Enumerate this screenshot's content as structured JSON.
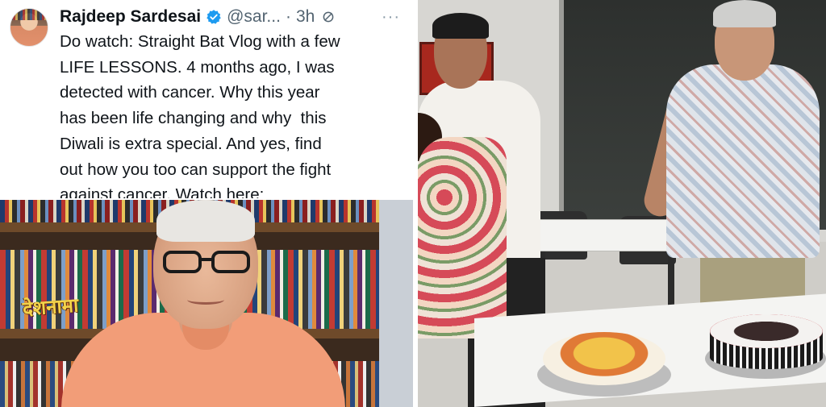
{
  "tweet": {
    "author_name": "Rajdeep Sardesai",
    "handle": "@sar...",
    "separator": "·",
    "time": "3h",
    "more_label": "···",
    "text": "Do watch: Straight Bat Vlog with a few\nLIFE LESSONS. 4 months ago, I was\ndetected with cancer. Why this year\nhas been life changing and why  this\nDiwali is extra special. And yes, find\nout how you too can support the fight\nagainst cancer. Watch here:"
  },
  "media": {
    "watermark_text": "देशनामा"
  },
  "colors": {
    "verified": "#1d9bf0",
    "text_primary": "#0f1419",
    "text_secondary": "#536471",
    "kurta": "#f29d78"
  },
  "icons": {
    "verified": "verified-badge-icon",
    "edited": "edit-icon",
    "more": "more-icon"
  }
}
